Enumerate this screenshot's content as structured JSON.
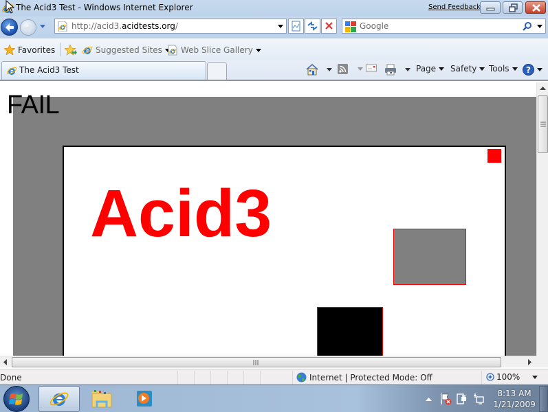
{
  "window": {
    "title": "The Acid3 Test - Windows Internet Explorer",
    "send_feedback": "Send Feedback",
    "minimize_label": "Minimize",
    "maximize_label": "Restore",
    "close_label": "Close"
  },
  "navbar": {
    "url_prefix": "http://acid3.",
    "url_domain": "acidtests.org",
    "url_suffix": "/",
    "search_placeholder": "Google"
  },
  "favorites_bar": {
    "favorites_label": "Favorites",
    "items": [
      {
        "label": "Suggested Sites",
        "icon": "ie-icon"
      },
      {
        "label": "Web Slice Gallery",
        "icon": "web-slice-icon"
      }
    ]
  },
  "tabs": [
    {
      "title": "The Acid3 Test",
      "active": true
    }
  ],
  "command_bar": {
    "page_label": "Page",
    "safety_label": "Safety",
    "tools_label": "Tools"
  },
  "page": {
    "result": "FAIL",
    "heading": "Acid3",
    "colors": {
      "accent": "#ff0000",
      "grey": "#808080",
      "black": "#000000"
    }
  },
  "status_bar": {
    "text": "Done",
    "zone": "Internet | Protected Mode: Off",
    "zoom": "100%"
  },
  "taskbar": {
    "time": "8:13 AM",
    "date": "1/21/2009",
    "pinned": [
      "internet-explorer",
      "windows-explorer",
      "windows-media-player"
    ]
  }
}
